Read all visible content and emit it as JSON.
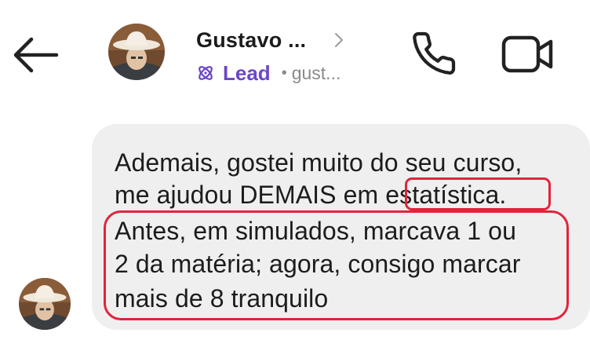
{
  "header": {
    "back_icon": "arrow-left-icon",
    "contact_name": "Gustavo ...",
    "chevron_icon": "chevron-right-icon",
    "badge_icon": "atom-icon",
    "badge_label": "Lead",
    "separator": "•",
    "handle": "gust...",
    "call_icon": "phone-icon",
    "video_icon": "video-camera-icon"
  },
  "message": {
    "lines": [
      "Ademais, gostei muito do seu curso,",
      "me ajudou DEMAIS em estatística.",
      "Antes, em simulados, marcava 1 ou",
      "2 da matéria; agora, consigo marcar",
      "mais de 8 tranquilo"
    ],
    "highlight_color": "#e0243b"
  },
  "colors": {
    "accent": "#6b47c8",
    "bubble": "#efeff0",
    "text": "#1c1c1c",
    "muted": "#8a8a8a"
  }
}
